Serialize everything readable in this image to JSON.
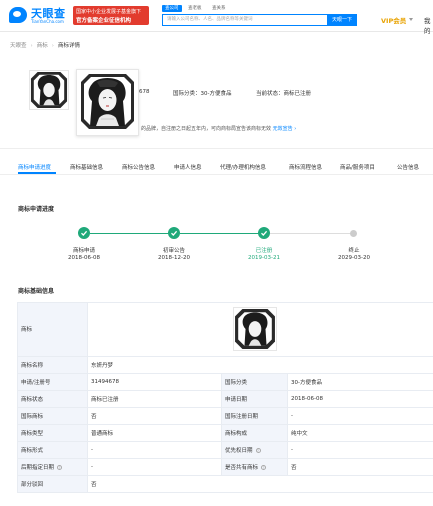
{
  "header": {
    "logo_text": "天眼查",
    "logo_url": "TianYanCha.com",
    "banner_line1": "国家中小企业发展子基金旗下",
    "banner_line2": "官方备案企业征信机构",
    "search_tabs": [
      "查公司",
      "查老板",
      "查关系"
    ],
    "search_placeholder": "请输入公司名称、人名、品牌名称等关键词",
    "search_button": "天眼一下",
    "vip_label": "VIP会员",
    "my_label": "我的"
  },
  "breadcrumb": [
    "天眼查",
    "商标",
    "商标详情"
  ],
  "top_info": {
    "partial_text": "678",
    "class_label": "国际分类：30-方便食品",
    "status_label": "当前状态：商标已注册",
    "notice_text": "的品牌，自注册之日起五年内，可向商标局宣告该商标无效",
    "notice_link": "无效宣告 ›"
  },
  "tabs": [
    "商标申请进度",
    "商标基础信息",
    "商标公告信息",
    "申请人信息",
    "代理/办理机构信息",
    "商标流程信息",
    "商品/服务项目",
    "公告信息"
  ],
  "progress": {
    "title": "商标申请进度",
    "steps": [
      {
        "label": "商标申请",
        "date": "2018-06-08",
        "state": "done"
      },
      {
        "label": "初审公告",
        "date": "2018-12-20",
        "state": "done"
      },
      {
        "label": "已注册",
        "date": "2019-03-21",
        "state": "current"
      },
      {
        "label": "终止",
        "date": "2029-03-20",
        "state": "pending"
      }
    ]
  },
  "basic_info": {
    "title": "商标基础信息",
    "image_label": "商标",
    "rows": [
      {
        "l1": "商标名称",
        "v1": "东妍丹梦",
        "l2": "",
        "v2": ""
      },
      {
        "l1": "申请/注册号",
        "v1": "31494678",
        "l2": "国际分类",
        "v2": "30-方便食品"
      },
      {
        "l1": "商标状态",
        "v1": "商标已注册",
        "l2": "申请日期",
        "v2": "2018-06-08"
      },
      {
        "l1": "国际商标",
        "v1": "否",
        "l2": "国际注册日期",
        "v2": "-"
      },
      {
        "l1": "商标类型",
        "v1": "普通商标",
        "l2": "商标构成",
        "v2": "纯中文"
      },
      {
        "l1": "商标形式",
        "v1": "-",
        "l2": "优先权日期",
        "v2": "-"
      },
      {
        "l1": "后期指定日期",
        "v1": "-",
        "l2": "是否共有商标",
        "v2": "否"
      },
      {
        "l1": "部分驳回",
        "v1": "否",
        "l2": "",
        "v2": ""
      }
    ]
  },
  "colors": {
    "brand": "#0084ff",
    "success": "#1fa97a",
    "vip": "#e8a200",
    "banner": "#e23b2e"
  }
}
